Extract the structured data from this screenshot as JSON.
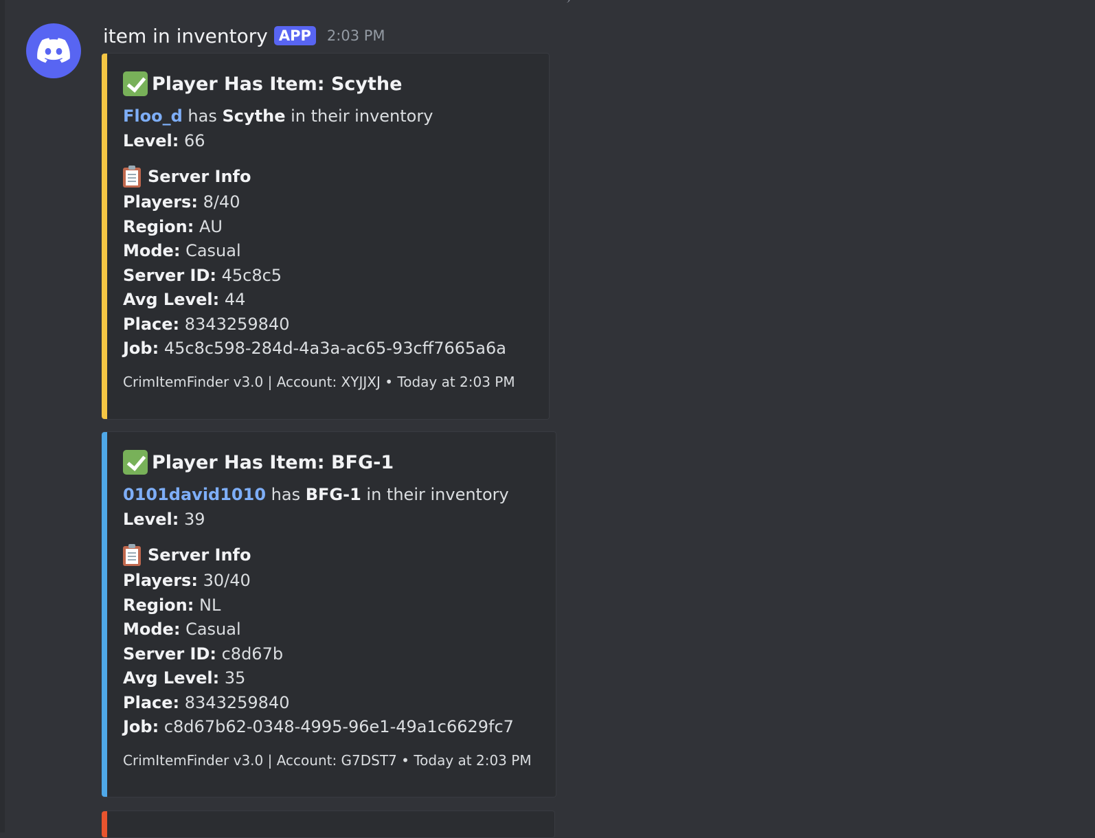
{
  "message": {
    "username": "item in inventory",
    "app_tag": "APP",
    "timestamp": "2:03 PM"
  },
  "embeds": [
    {
      "accent_color": "#f5c644",
      "title": "Player Has Item: Scythe",
      "player": "Floo_d",
      "has_word": "has",
      "item": "Scythe",
      "suffix": "in their inventory",
      "level_label": "Level:",
      "level": "66",
      "server_info_heading": "Server Info",
      "fields": [
        {
          "label": "Players:",
          "value": "8/40"
        },
        {
          "label": "Region:",
          "value": "AU"
        },
        {
          "label": "Mode:",
          "value": "Casual"
        },
        {
          "label": "Server ID:",
          "value": "45c8c5"
        },
        {
          "label": "Avg Level:",
          "value": "44"
        },
        {
          "label": "Place:",
          "value": "8343259840"
        },
        {
          "label": "Job:",
          "value": "45c8c598-284d-4a3a-ac65-93cff7665a6a"
        }
      ],
      "footer": "CrimItemFinder v3.0 | Account: XYJJXJ • Today at 2:03 PM"
    },
    {
      "accent_color": "#4fa8e8",
      "title": "Player Has Item: BFG-1",
      "player": "0101david1010",
      "has_word": "has",
      "item": "BFG-1",
      "suffix": "in their inventory",
      "level_label": "Level:",
      "level": "39",
      "server_info_heading": "Server Info",
      "fields": [
        {
          "label": "Players:",
          "value": "30/40"
        },
        {
          "label": "Region:",
          "value": "NL"
        },
        {
          "label": "Mode:",
          "value": "Casual"
        },
        {
          "label": "Server ID:",
          "value": "c8d67b"
        },
        {
          "label": "Avg Level:",
          "value": "35"
        },
        {
          "label": "Place:",
          "value": "8343259840"
        },
        {
          "label": "Job:",
          "value": "c8d67b62-0348-4995-96e1-49a1c6629fc7"
        }
      ],
      "footer": "CrimItemFinder v3.0 | Account: G7DST7 • Today at 2:03 PM"
    }
  ],
  "partial_embed_accent": "#e8542e",
  "icons": {
    "avatar": "discord-logo-icon",
    "title": "check-mark-button-icon",
    "server_info": "clipboard-icon"
  }
}
